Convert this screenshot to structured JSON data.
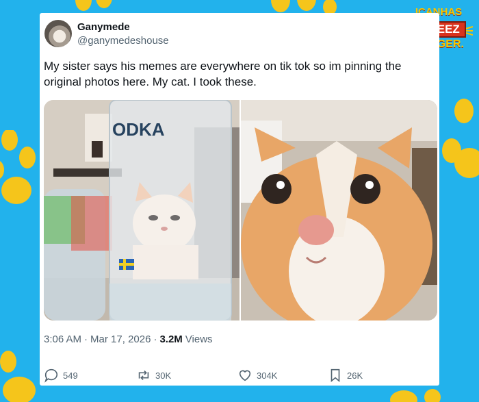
{
  "brand": {
    "logo_line1": "ICANHAS",
    "logo_line2": "CHEEZ",
    "logo_line3": "BURGER."
  },
  "tweet": {
    "author_name": "Ganymede",
    "author_handle": "@ganymedeshouse",
    "text": "My sister says his memes are everywhere on tik tok so im pinning the original photos here. My cat. I took these.",
    "photos": [
      {
        "icon": "cat-behind-vodka-bottle-photo",
        "bottle_text": "ODKA"
      },
      {
        "icon": "cat-closeup-photo"
      }
    ],
    "time": "3:06 AM",
    "date": "Mar 17, 2026",
    "separator": "·",
    "views_count": "3.2M",
    "views_label": "Views"
  },
  "actions": {
    "replies": "549",
    "reposts": "30K",
    "likes": "304K",
    "bookmarks": "26K"
  },
  "colors": {
    "background": "#22b2ec",
    "paw": "#f5c51b",
    "card": "#ffffff",
    "muted_text": "#536471"
  }
}
